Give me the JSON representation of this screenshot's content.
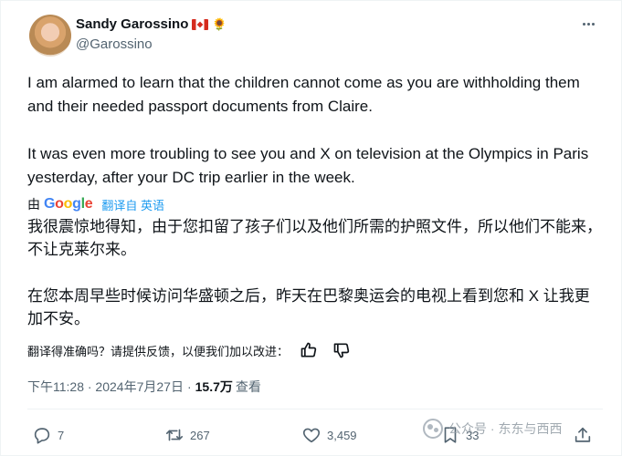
{
  "author": {
    "display_name": "Sandy Garossino",
    "handle": "@Garossino",
    "emoji_suffix": "🌻"
  },
  "tweet": {
    "paragraphs_en": [
      "I am alarmed to learn that the children cannot come as you are withholding them and their needed passport documents from Claire.",
      "It was even more troubling to see you and X on television at the Olympics in Paris yesterday, after your DC trip earlier in the week."
    ],
    "translation": {
      "by_label": "由",
      "provider_letters": [
        "G",
        "o",
        "o",
        "g",
        "l",
        "e"
      ],
      "translated_from": "翻译自 英语",
      "paragraphs_zh": [
        "我很震惊地得知，由于您扣留了孩子们以及他们所需的护照文件，所以他们不能来，不让克莱尔来。",
        "在您本周早些时候访问华盛顿之后，昨天在巴黎奥运会的电视上看到您和 X 让我更加不安。"
      ],
      "feedback_prompt": "翻译得准确吗？请提供反馈，以便我们加以改进："
    },
    "timestamp": "下午11:28 · 2024年7月27日",
    "views_count": "15.7万",
    "views_label": "查看"
  },
  "actions": {
    "replies": "7",
    "retweets": "267",
    "likes": "3,459",
    "bookmarks": "33"
  },
  "watermark": {
    "text": "公众号 · 东东与西西"
  },
  "colors": {
    "text_primary": "#0f1419",
    "text_secondary": "#536471",
    "link": "#1d9bf0",
    "divider": "#eff3f4"
  }
}
